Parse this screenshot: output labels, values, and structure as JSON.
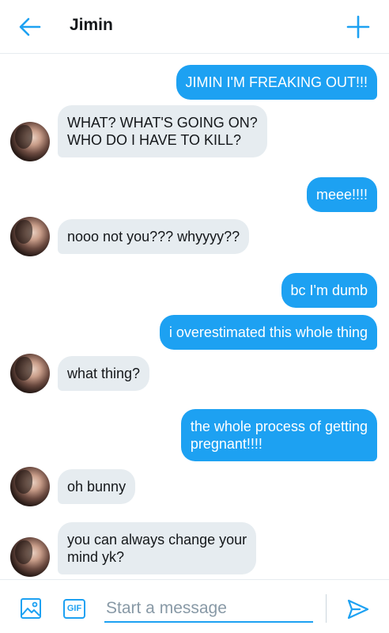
{
  "header": {
    "title": "Jimin",
    "back_icon": "arrow-left-icon",
    "add_icon": "plus-icon"
  },
  "messages": [
    {
      "sender": "me",
      "text": "JIMIN I'M FREAKING OUT!!!"
    },
    {
      "sender": "Jimin",
      "text": "WHAT? WHAT'S GOING ON?\nWHO DO I HAVE TO KILL?"
    },
    {
      "sender": "me",
      "text": "meee!!!!"
    },
    {
      "sender": "Jimin",
      "text": "nooo not you??? whyyyy??"
    },
    {
      "sender": "me",
      "text": "bc I'm dumb"
    },
    {
      "sender": "me",
      "text": "i overestimated this whole thing"
    },
    {
      "sender": "Jimin",
      "text": "what thing?"
    },
    {
      "sender": "me",
      "text": "the whole process of getting\npregnant!!!!"
    },
    {
      "sender": "Jimin",
      "text": "oh bunny"
    },
    {
      "sender": "Jimin",
      "text": "you can always change your\nmind yk?"
    }
  ],
  "composer": {
    "placeholder": "Start a message",
    "gif_label": "GIF",
    "image_icon": "image-icon",
    "send_icon": "send-icon"
  },
  "colors": {
    "accent": "#1da1f2",
    "incoming_bubble": "#e6ecf0",
    "outgoing_bubble": "#1da1f2"
  }
}
